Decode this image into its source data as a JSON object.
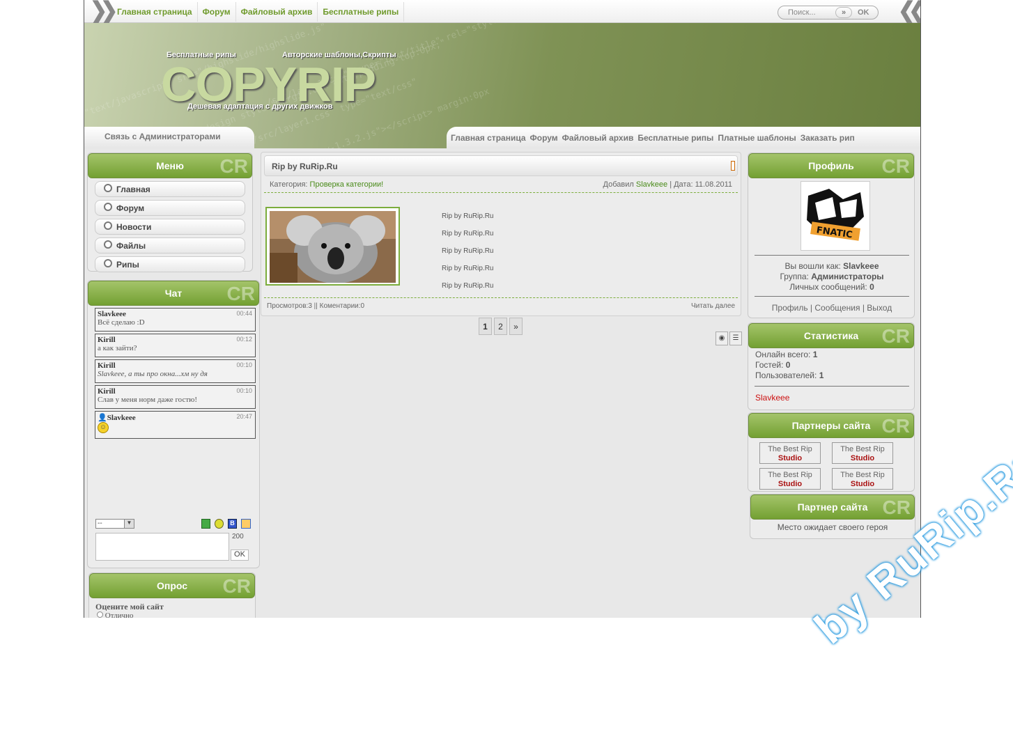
{
  "topbar": {
    "nav": [
      "Главная страница",
      "Форум",
      "Файловый архив",
      "Бесплатные рипы"
    ],
    "search_placeholder": "Поиск...",
    "search_go": "»",
    "search_ok": "OK"
  },
  "header": {
    "logo": "COPYRIP",
    "tagline_left": "Бесплатные рипы",
    "tagline_right": "Авторские шаблоны,Скрипты",
    "subtitle": "Дешевая адаптация с других движков"
  },
  "subnav": {
    "contact": "Связь с Администраторами",
    "items": [
      "Главная страница",
      "Форум",
      "Файловый архив",
      "Бесплатные рипы",
      "Платные шаблоны",
      "Заказать рип"
    ]
  },
  "menu": {
    "title": "Меню",
    "cr": "CR",
    "items": [
      "Главная",
      "Форум",
      "Новости",
      "Файлы",
      "Рипы"
    ]
  },
  "chat": {
    "title": "Чат",
    "messages": [
      {
        "user": "Slavkeee",
        "time": "00:44",
        "text": "Всё сделаю :D"
      },
      {
        "user": "Kirill",
        "time": "00:12",
        "text": "а как зайти?"
      },
      {
        "user": "Kirill",
        "time": "00:10",
        "text": "Slavkeee, а ты про окна...хм ну дя"
      },
      {
        "user": "Kirill",
        "time": "00:10",
        "text": "Слав у меня норм даже гостю!"
      },
      {
        "user": "Slavkeee",
        "time": "20:47",
        "text": ""
      }
    ],
    "select": "--",
    "counter": "200",
    "ok": "OK"
  },
  "poll": {
    "title": "Опрос",
    "question": "Оцените мой сайт",
    "option": "Отлично"
  },
  "post": {
    "title": "Rip by RuRip.Ru",
    "category_label": "Категория:",
    "category": "Проверка категории!",
    "added_label": "Добавил",
    "author": "Slavkeee",
    "date": "| Дата: 11.08.2011",
    "lines": [
      "Rip by RuRip.Ru",
      "Rip by RuRip.Ru",
      "Rip by RuRip.Ru",
      "Rip by RuRip.Ru",
      "Rip by RuRip.Ru"
    ],
    "views": "Просмотров:3 || Коментарии:0",
    "more": "Читать далее"
  },
  "pagination": [
    "1",
    "2",
    "»"
  ],
  "profile": {
    "title": "Профиль",
    "logged": "Вы вошли как:",
    "user": "Slavkeee",
    "group_label": "Группа:",
    "group": "Администраторы",
    "pm_label": "Личных сообщений:",
    "pm": "0",
    "links": "Профиль | Сообщения | Выход",
    "avatar_text": "FNATIC"
  },
  "stats": {
    "title": "Статистика",
    "online_label": "Онлайн всего:",
    "online": "1",
    "guests_label": "Гостей:",
    "guests": "0",
    "users_label": "Пользователей:",
    "users": "1",
    "user": "Slavkeee"
  },
  "partners": {
    "title": "Партнеры сайта",
    "banner_top": "The Best Rip",
    "banner_bottom": "Studio"
  },
  "partner": {
    "title": "Партнер сайта",
    "text": "Место ожидает своего героя"
  },
  "watermark": "by RuRip.Ru"
}
